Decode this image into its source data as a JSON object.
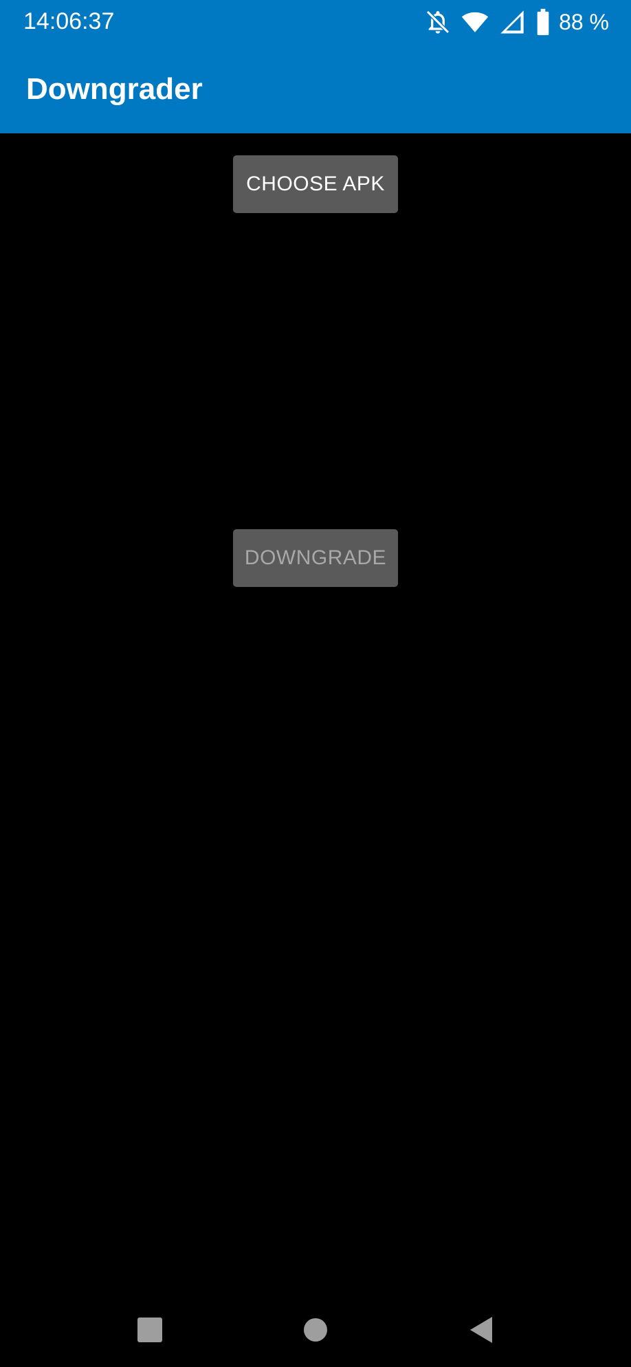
{
  "status_bar": {
    "time": "14:06:37",
    "battery_percent": "88 %",
    "icons": [
      "bell-off-icon",
      "wifi-icon",
      "cell-signal-icon",
      "battery-icon"
    ]
  },
  "app_bar": {
    "title": "Downgrader",
    "color": "#0079C2"
  },
  "main": {
    "choose_apk_label": "CHOOSE APK",
    "downgrade_label": "DOWNGRADE",
    "downgrade_enabled": false,
    "background": "#000000",
    "button_color": "#5a5a5a"
  },
  "nav_bar": {
    "icons": [
      "recents-icon",
      "home-icon",
      "back-icon"
    ]
  }
}
